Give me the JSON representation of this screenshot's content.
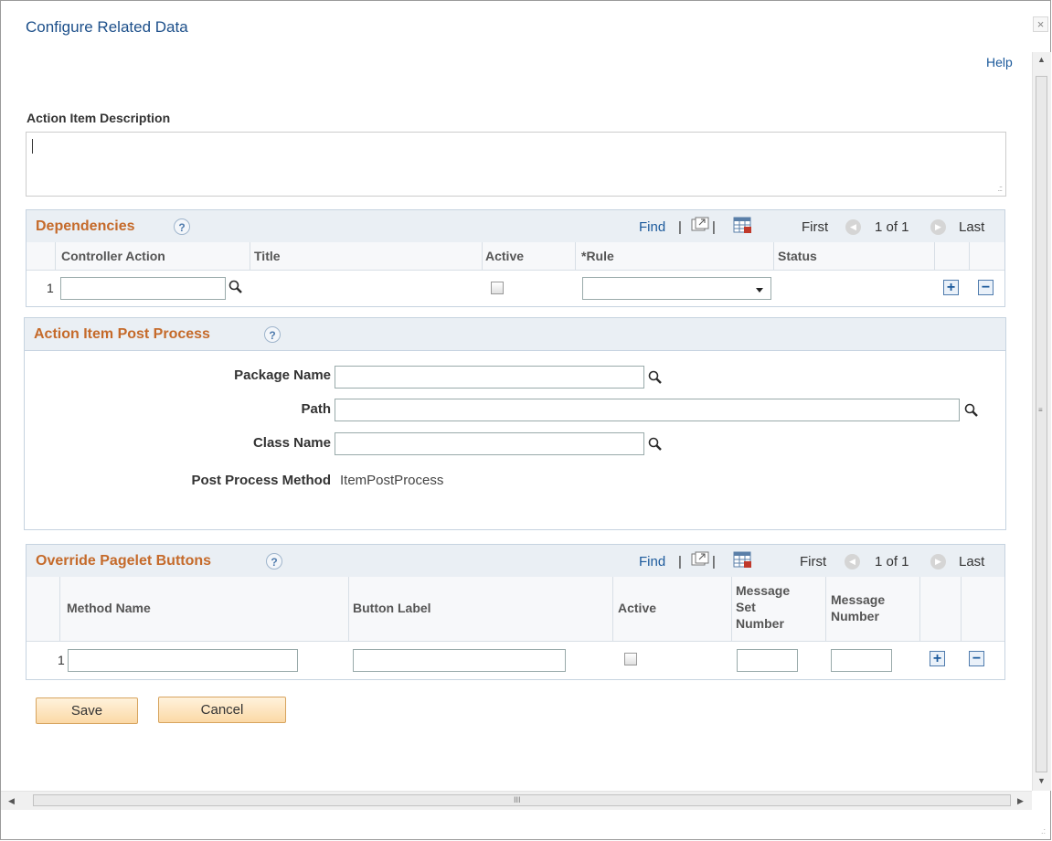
{
  "window": {
    "title": "Configure Related Data",
    "close_glyph": "×"
  },
  "help_link": "Help",
  "description": {
    "label": "Action Item Description",
    "value": ""
  },
  "dependencies": {
    "title": "Dependencies",
    "help_glyph": "?",
    "nav": {
      "find": "Find",
      "sep": "|",
      "first": "First",
      "range": "1 of 1",
      "last": "Last"
    },
    "columns": [
      "Controller Action",
      "Title",
      "Active",
      "*Rule",
      "Status"
    ],
    "rows": [
      {
        "num": "1",
        "controller_action": "",
        "title": "",
        "active": false,
        "rule": "",
        "status": ""
      }
    ]
  },
  "post_process": {
    "title": "Action Item Post Process",
    "help_glyph": "?",
    "package_label": "Package Name",
    "package_value": "",
    "path_label": "Path",
    "path_value": "",
    "class_label": "Class Name",
    "class_value": "",
    "method_label": "Post Process Method",
    "method_value": "ItemPostProcess"
  },
  "override_buttons": {
    "title": "Override Pagelet Buttons",
    "help_glyph": "?",
    "nav": {
      "find": "Find",
      "sep": "|",
      "first": "First",
      "range": "1 of 1",
      "last": "Last"
    },
    "columns": {
      "method_name": "Method Name",
      "button_label": "Button Label",
      "active": "Active",
      "message_set_number": "Message Set Number",
      "message_number": "Message Number"
    },
    "rows": [
      {
        "num": "1",
        "method_name": "",
        "button_label": "",
        "active": false,
        "message_set_number": "",
        "message_number": ""
      }
    ]
  },
  "buttons": {
    "save": "Save",
    "cancel": "Cancel"
  },
  "glyphs": {
    "add": "+",
    "remove": "−",
    "first_arrow": "◀",
    "next_arrow": "▶",
    "scroll_up": "▲",
    "scroll_down": "▼",
    "scroll_left": "◀",
    "scroll_right": "▶",
    "grip": "III"
  }
}
